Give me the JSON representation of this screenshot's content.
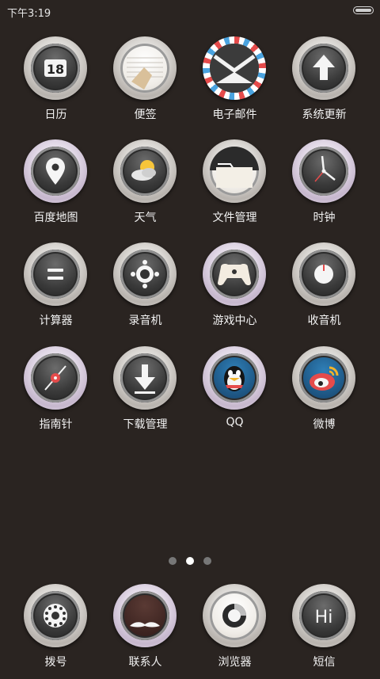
{
  "status": {
    "time": "下午3:19"
  },
  "apps": [
    {
      "label": "日历",
      "icon": "calendar-icon"
    },
    {
      "label": "便签",
      "icon": "notes-icon"
    },
    {
      "label": "电子邮件",
      "icon": "email-icon"
    },
    {
      "label": "系统更新",
      "icon": "update-arrow-icon"
    },
    {
      "label": "百度地图",
      "icon": "map-pin-icon"
    },
    {
      "label": "天气",
      "icon": "weather-icon"
    },
    {
      "label": "文件管理",
      "icon": "folder-icon"
    },
    {
      "label": "时钟",
      "icon": "clock-icon"
    },
    {
      "label": "计算器",
      "icon": "calculator-icon"
    },
    {
      "label": "录音机",
      "icon": "recorder-icon"
    },
    {
      "label": "游戏中心",
      "icon": "gamepad-icon"
    },
    {
      "label": "收音机",
      "icon": "radio-knob-icon"
    },
    {
      "label": "指南针",
      "icon": "compass-icon"
    },
    {
      "label": "下载管理",
      "icon": "download-icon"
    },
    {
      "label": "QQ",
      "icon": "qq-penguin-icon"
    },
    {
      "label": "微博",
      "icon": "weibo-icon"
    }
  ],
  "calendar_day": "18",
  "pager": {
    "count": 3,
    "active": 1
  },
  "dock": [
    {
      "label": "拨号",
      "icon": "dialer-icon"
    },
    {
      "label": "联系人",
      "icon": "contacts-icon"
    },
    {
      "label": "浏览器",
      "icon": "browser-icon"
    },
    {
      "label": "短信",
      "icon": "messages-icon"
    }
  ],
  "messages_icon_text": "Hi"
}
